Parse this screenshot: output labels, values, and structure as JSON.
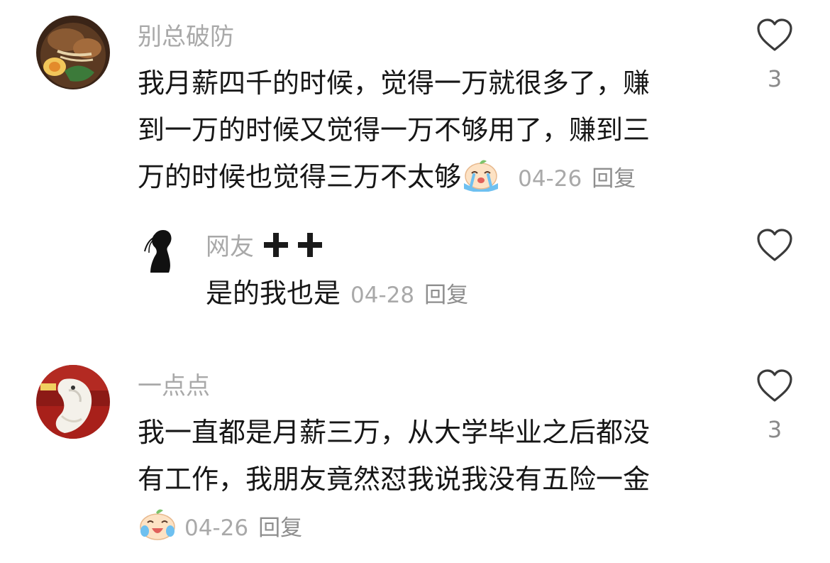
{
  "comments": [
    {
      "username": "别总破防",
      "lines": [
        "我月薪四千的时候，觉得一万就很多了，赚",
        "到一万的时候又觉得一万不够用了，赚到三",
        "万的时候也觉得三万不太够"
      ],
      "emoji": "crying-face-emoji",
      "date": "04-26",
      "reply_label": "回复",
      "like_icon": "heart-outline-icon",
      "like_count": "3"
    },
    {
      "username": "网友",
      "badges": [
        "plus-icon",
        "plus-icon"
      ],
      "text": "是的我也是",
      "date": "04-28",
      "reply_label": "回复",
      "like_icon": "heart-outline-icon"
    },
    {
      "username": "一点点",
      "lines": [
        "我一直都是月薪三万，从大学毕业之后都没",
        "有工作，我朋友竟然怼我说我没有五险一金"
      ],
      "emoji": "crying-face-emoji",
      "date": "04-26",
      "reply_label": "回复",
      "like_icon": "heart-outline-icon",
      "like_count": "3"
    }
  ]
}
